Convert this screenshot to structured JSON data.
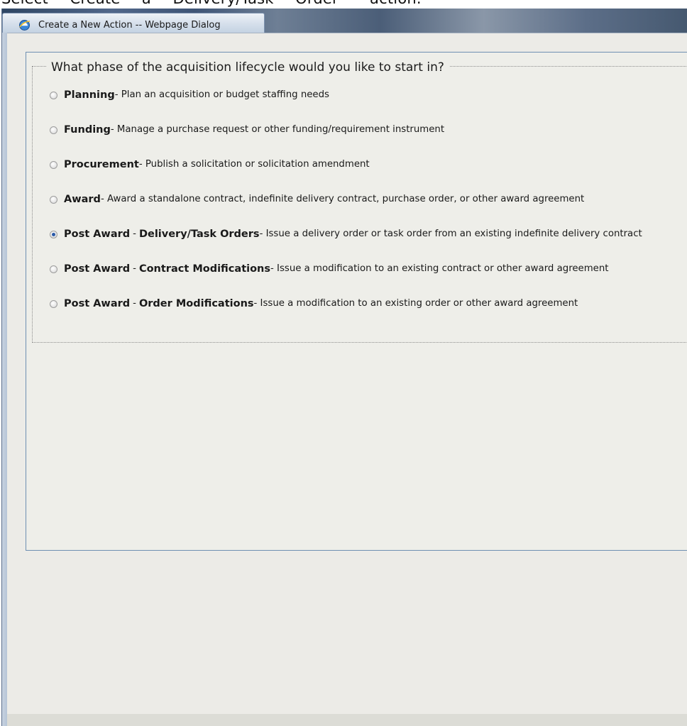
{
  "caption": "Select   \"Create\"   a   \"Delivery/Task\"   Order   \"  action.",
  "window": {
    "title": "Create a New Action -- Webpage Dialog",
    "icon": "ie-icon"
  },
  "form": {
    "legend": "What phase of the acquisition lifecycle would you like to start in?",
    "options": [
      {
        "label_part1": "Planning",
        "sep": "",
        "label_part2": "",
        "description": " - Plan an acquisition or budget staffing needs",
        "selected": false
      },
      {
        "label_part1": "Funding",
        "sep": "",
        "label_part2": "",
        "description": " - Manage a purchase request or other funding/requirement instrument",
        "selected": false
      },
      {
        "label_part1": "Procurement",
        "sep": "",
        "label_part2": "",
        "description": " - Publish a solicitation or solicitation amendment",
        "selected": false
      },
      {
        "label_part1": "Award",
        "sep": "",
        "label_part2": "",
        "description": " - Award a standalone contract, indefinite delivery contract, purchase order, or other award agreement",
        "selected": false
      },
      {
        "label_part1": "Post Award",
        "sep": "-",
        "label_part2": "Delivery/Task Orders",
        "description": " - Issue a delivery order or task order from an existing indefinite delivery contract",
        "selected": true
      },
      {
        "label_part1": "Post Award",
        "sep": "-",
        "label_part2": "Contract Modifications",
        "description": " - Issue a modification to an existing contract or other award agreement",
        "selected": false
      },
      {
        "label_part1": "Post Award",
        "sep": "-",
        "label_part2": "Order Modifications",
        "description": " - Issue a modification to an existing order or other award agreement",
        "selected": false
      }
    ]
  },
  "colors": {
    "selected_radio": "#2a5aa8",
    "panel_border": "#6e8fb2",
    "background": "#eeeee9"
  }
}
